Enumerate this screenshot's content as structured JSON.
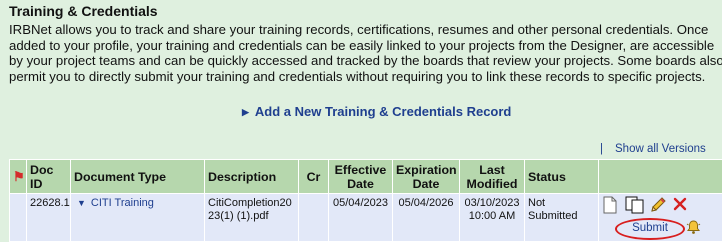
{
  "section": {
    "title": "Training & Credentials",
    "intro": "IRBNet allows you to track and share your training records, certifications, resumes and other personal credentials. Once added to your profile, your training and credentials can be easily linked to your projects from the Designer, are accessible by your project teams and can be quickly accessed and tracked by the boards that review your projects. Some boards also permit you to directly submit your training and credentials without requiring you to link these records to specific projects."
  },
  "add_link": {
    "label": "Add a New Training & Credentials Record"
  },
  "show_all": {
    "separator": "|",
    "label": "Show all Versions"
  },
  "table": {
    "headers": {
      "doc_id": "Doc ID",
      "doc_type": "Document Type",
      "description": "Description",
      "cr": "Cr",
      "effective_1": "Effective",
      "effective_2": "Date",
      "expiration_1": "Expiration",
      "expiration_2": "Date",
      "last_modified_1": "Last",
      "last_modified_2": "Modified",
      "status": "Status"
    },
    "rows": [
      {
        "doc_id": "22628.1",
        "doc_type": "CITI Training",
        "description": "CitiCompletion2023(1) (1).pdf",
        "cr": "",
        "effective": "05/04/2023",
        "expiration": "05/04/2026",
        "last_modified_date": "03/10/2023",
        "last_modified_time": "10:00 AM",
        "status": "Not Submitted",
        "submit_label": "Submit"
      }
    ]
  },
  "colors": {
    "page_bg": "#dff0df",
    "header_bg": "#b6d7ad",
    "row_bg": "#e2e8f8",
    "link": "#1f3f8f",
    "highlight_ring": "#d81e1e"
  }
}
